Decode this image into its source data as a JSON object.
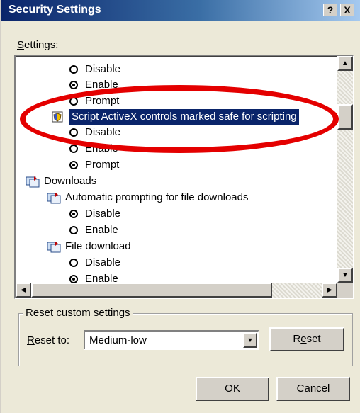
{
  "window": {
    "title": "Security Settings",
    "help_label": "?",
    "close_label": "X"
  },
  "settings": {
    "label_underlined": "S",
    "label_rest": "ettings:",
    "items": [
      {
        "label": "Disable",
        "kind": "radio",
        "checked": false
      },
      {
        "label": "Enable",
        "kind": "radio",
        "checked": true
      },
      {
        "label": "Prompt",
        "kind": "radio",
        "checked": false
      },
      {
        "label": "Script ActiveX controls marked safe for scripting",
        "kind": "node",
        "selected": true
      },
      {
        "label": "Disable",
        "kind": "radio",
        "checked": false
      },
      {
        "label": "Enable",
        "kind": "radio",
        "checked": false
      },
      {
        "label": "Prompt",
        "kind": "radio",
        "checked": true
      },
      {
        "label": "Downloads",
        "kind": "group"
      },
      {
        "label": "Automatic prompting for file downloads",
        "kind": "node"
      },
      {
        "label": "Disable",
        "kind": "radio",
        "checked": true
      },
      {
        "label": "Enable",
        "kind": "radio",
        "checked": false
      },
      {
        "label": "File download",
        "kind": "node"
      },
      {
        "label": "Disable",
        "kind": "radio",
        "checked": false
      },
      {
        "label": "Enable",
        "kind": "radio",
        "checked": true
      }
    ]
  },
  "reset_group": {
    "title": "Reset custom settings",
    "reset_to_underlined": "R",
    "reset_to_rest": "eset to:",
    "selected_value": "Medium-low",
    "reset_button_pre": "R",
    "reset_button_underlined": "e",
    "reset_button_post": "set"
  },
  "buttons": {
    "ok": "OK",
    "cancel": "Cancel"
  },
  "colors": {
    "annotation": "#e40000",
    "selection": "#0a246a",
    "titlebar": "#0a246a"
  }
}
